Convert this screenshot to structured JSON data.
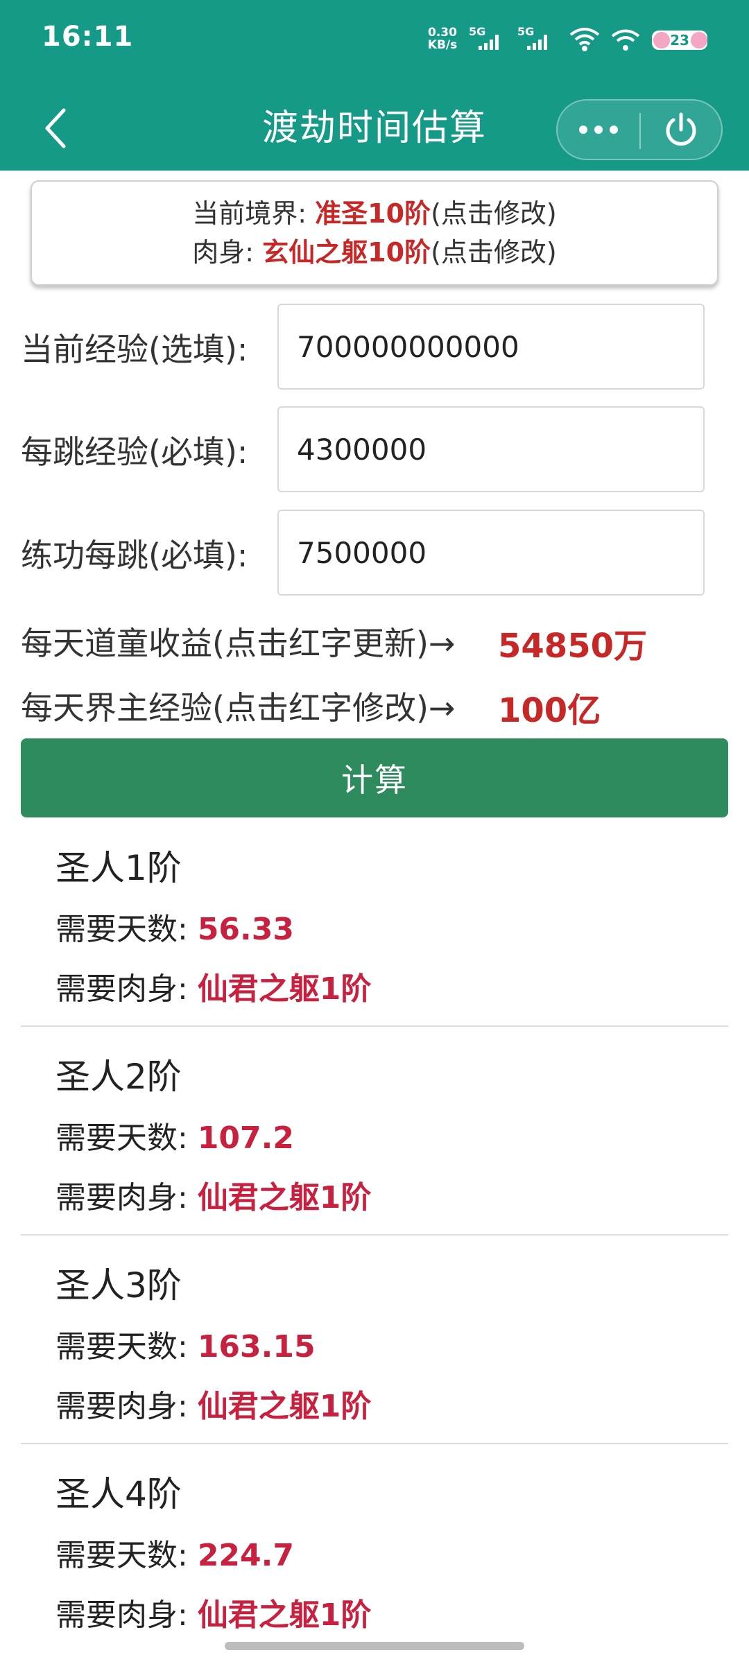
{
  "status_bar": {
    "time": "16:11",
    "net_speed_value": "0.30",
    "net_speed_unit": "KB/s",
    "signal1_label": "5G",
    "signal2_label": "5G",
    "battery": "23"
  },
  "nav": {
    "title": "渡劫时间估算"
  },
  "realm": {
    "current_label": "当前境界: ",
    "current_value": "准圣10阶",
    "current_hint": "(点击修改)",
    "body_label": "肉身: ",
    "body_value": "玄仙之躯10阶",
    "body_hint": "(点击修改)"
  },
  "form": {
    "current_exp_label": "当前经验(选填):",
    "current_exp_value": "700000000000",
    "per_tick_exp_label": "每跳经验(必填):",
    "per_tick_exp_value": "4300000",
    "practice_per_tick_label": "练功每跳(必填):",
    "practice_per_tick_value": "7500000"
  },
  "daily": {
    "daotong_label": "每天道童收益(点击红字更新)→",
    "daotong_value": "54850万",
    "jiezhu_label": "每天界主经验(点击红字修改)→",
    "jiezhu_value": "100亿"
  },
  "calc_button": "计算",
  "results": [
    {
      "title": "圣人1阶",
      "days_label": "需要天数: ",
      "days": "56.33",
      "body_label": "需要肉身: ",
      "body": "仙君之躯1阶"
    },
    {
      "title": "圣人2阶",
      "days_label": "需要天数: ",
      "days": "107.2",
      "body_label": "需要肉身: ",
      "body": "仙君之躯1阶"
    },
    {
      "title": "圣人3阶",
      "days_label": "需要天数: ",
      "days": "163.15",
      "body_label": "需要肉身: ",
      "body": "仙君之躯1阶"
    },
    {
      "title": "圣人4阶",
      "days_label": "需要天数: ",
      "days": "224.7",
      "body_label": "需要肉身: ",
      "body": "仙君之躯1阶"
    }
  ],
  "colors": {
    "header": "#169a88",
    "button": "#2e8b5e",
    "highlight": "#c62828"
  }
}
